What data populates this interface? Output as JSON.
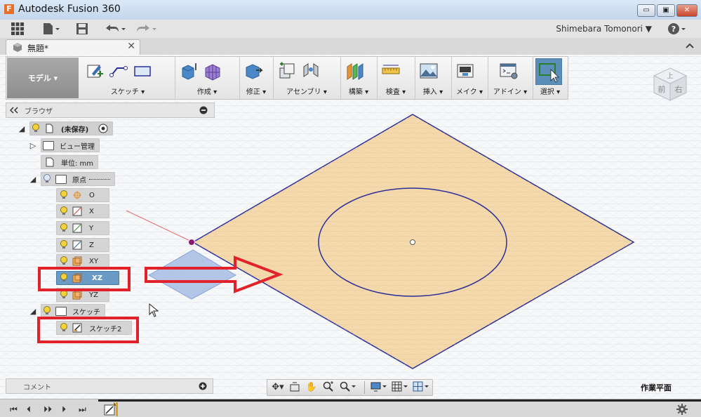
{
  "window": {
    "title": "Autodesk Fusion 360",
    "minimize": "▭",
    "maximize": "▣",
    "close": "✕"
  },
  "quickbar": {
    "user": "Shimebara Tomonori ▼",
    "help": "?"
  },
  "doc_tab": {
    "name": "無題*",
    "close": "✕"
  },
  "ribbon": {
    "workspace": "モデル ▾",
    "groups": [
      {
        "label": "スケッチ ▾"
      },
      {
        "label": "作成 ▾"
      },
      {
        "label": "修正 ▾"
      },
      {
        "label": "アセンブリ ▾"
      },
      {
        "label": "構築 ▾"
      },
      {
        "label": "検査 ▾"
      },
      {
        "label": "挿入 ▾"
      },
      {
        "label": "メイク ▾"
      },
      {
        "label": "アドイン ▾"
      },
      {
        "label": "選択 ▾"
      }
    ]
  },
  "viewcube": {
    "front": "前",
    "right": "右",
    "top": "上"
  },
  "browser": {
    "title": "ブラウザ",
    "root": "(未保存)",
    "view_mgmt": "ビュー管理",
    "units": "単位: mm",
    "origin": "原点",
    "origin_items": [
      "O",
      "X",
      "Y",
      "Z",
      "XY",
      "XZ",
      "YZ"
    ],
    "sketches": "スケッチ",
    "sketch_items": [
      "スケッチ2"
    ]
  },
  "comments": {
    "title": "コメント"
  },
  "statusbar": {
    "work_plane": "作業平面"
  },
  "colors": {
    "highlight_box": "#e3212b",
    "plane_fill": "#f4d9ac",
    "sketch_line": "#2c2f9a",
    "selected": "#6a9ac6"
  }
}
